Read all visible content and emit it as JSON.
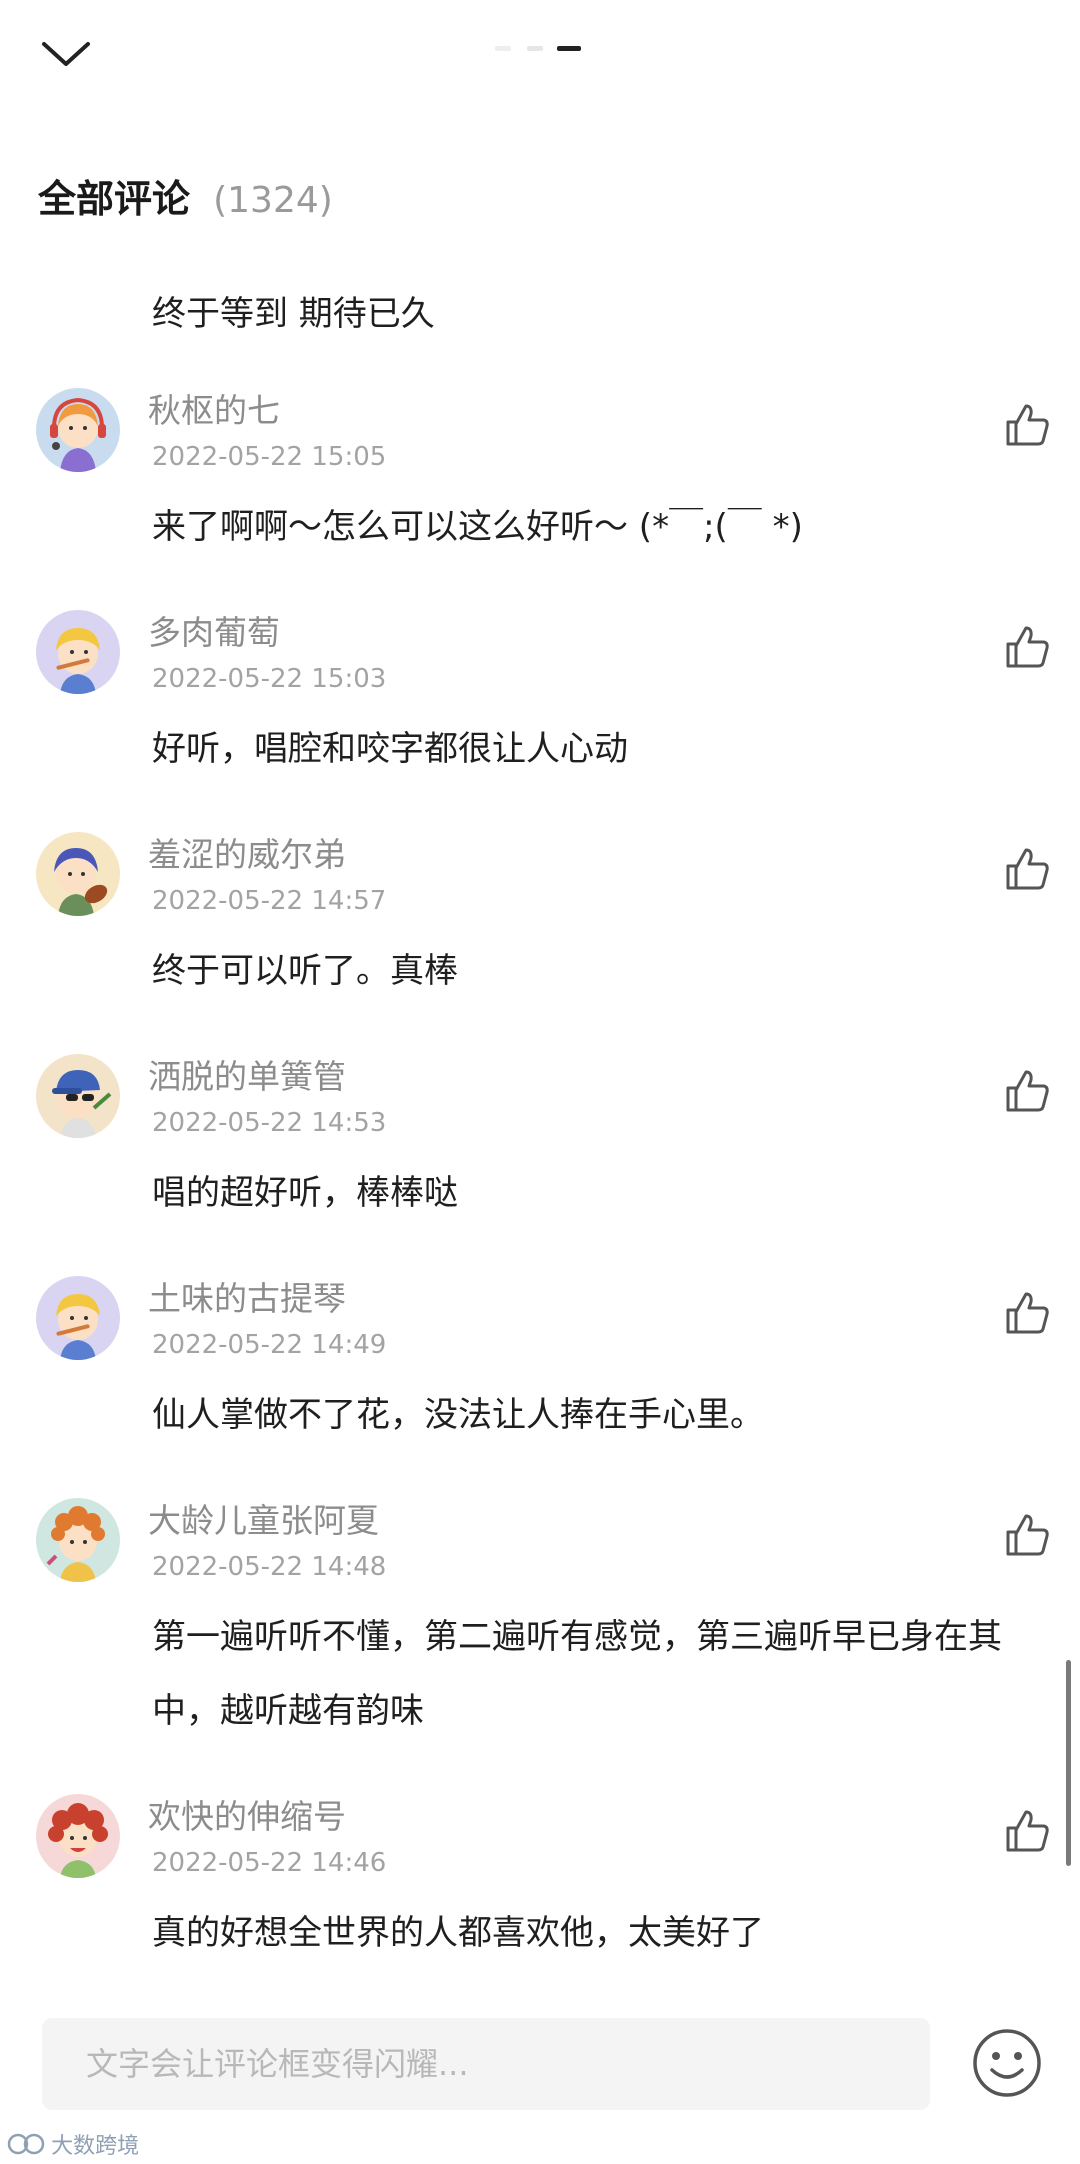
{
  "header": {
    "title": "全部评论",
    "count": "(1324)"
  },
  "first_comment_text": "终于等到 期待已久",
  "comments": [
    {
      "username": "秋枢的七",
      "timestamp": "2022-05-22 15:05",
      "text": "来了啊啊～怎么可以这么好听～ (*￣;(￣ *)",
      "avatar": "girl-headphones-avatar"
    },
    {
      "username": "多肉葡萄",
      "timestamp": "2022-05-22 15:03",
      "text": "好听，唱腔和咬字都很让人心动",
      "avatar": "boy-flute-avatar"
    },
    {
      "username": "羞涩的威尔弟",
      "timestamp": "2022-05-22 14:57",
      "text": "终于可以听了。真棒",
      "avatar": "boy-violin-avatar"
    },
    {
      "username": "洒脱的单簧管",
      "timestamp": "2022-05-22 14:53",
      "text": "唱的超好听，棒棒哒",
      "avatar": "cap-sunglasses-avatar"
    },
    {
      "username": "土味的古提琴",
      "timestamp": "2022-05-22 14:49",
      "text": "仙人掌做不了花，没法让人捧在手心里。",
      "avatar": "boy-flute-avatar"
    },
    {
      "username": "大龄儿童张阿夏",
      "timestamp": "2022-05-22 14:48",
      "text": "第一遍听听不懂，第二遍听有感觉，第三遍听早已身在其中，越听越有韵味",
      "avatar": "curly-hair-avatar"
    },
    {
      "username": "欢快的伸缩号",
      "timestamp": "2022-05-22 14:46",
      "text": "真的好想全世界的人都喜欢他，太美好了",
      "avatar": "red-curly-avatar"
    }
  ],
  "input": {
    "placeholder": "文字会让评论框变得闪耀..."
  },
  "watermark": {
    "text": "大数跨境"
  },
  "colors": {
    "avatar_bg_1": "#c9dcef",
    "avatar_bg_2": "#d9d4f2",
    "avatar_bg_3": "#f6e6c2",
    "avatar_bg_4": "#f3e3c8",
    "avatar_bg_5": "#cfe6e1",
    "avatar_bg_6": "#f6d8d8"
  }
}
